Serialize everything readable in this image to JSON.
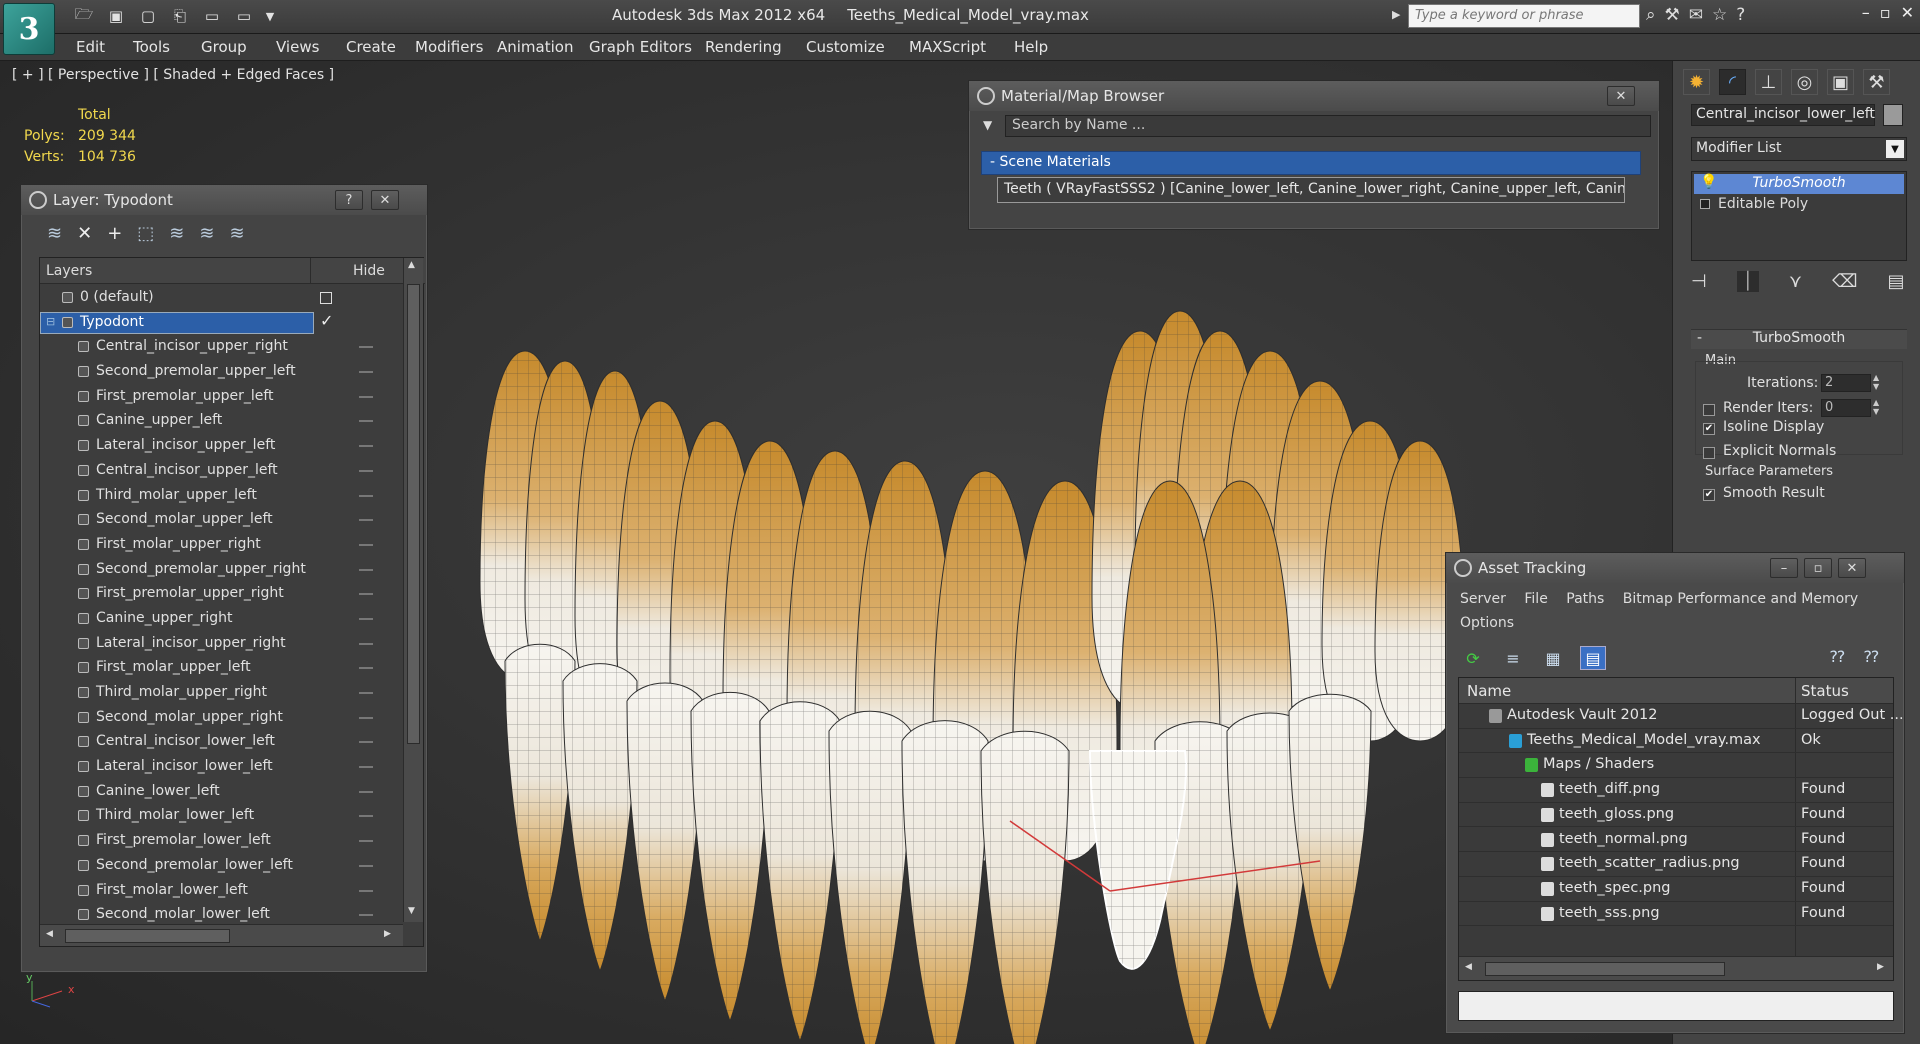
{
  "app": {
    "title": "Autodesk 3ds Max  2012 x64",
    "file": "Teeths_Medical_Model_vray.max",
    "logo": "3",
    "search_placeholder": "Type a keyword or phrase"
  },
  "menu": [
    "Edit",
    "Tools",
    "Group",
    "Views",
    "Create",
    "Modifiers",
    "Animation",
    "Graph Editors",
    "Rendering",
    "Customize",
    "MAXScript",
    "Help"
  ],
  "viewport": {
    "label": "[ + ] [ Perspective ] [ Shaded + Edged Faces ]",
    "stats_total": "Total",
    "polys_label": "Polys:",
    "polys": "209 344",
    "verts_label": "Verts:",
    "verts": "104 736",
    "axis_x": "x",
    "axis_y": "y"
  },
  "layer_window": {
    "title": "Layer: Typodont",
    "help": "?",
    "close": "✕",
    "col_layers": "Layers",
    "col_hide": "Hide",
    "default_layer": "0 (default)",
    "active_layer": "Typodont",
    "check": "✓",
    "objects": [
      "Central_incisor_upper_right",
      "Second_premolar_upper_left",
      "First_premolar_upper_left",
      "Canine_upper_left",
      "Lateral_incisor_upper_left",
      "Central_incisor_upper_left",
      "Third_molar_upper_left",
      "Second_molar_upper_left",
      "First_molar_upper_right",
      "Second_premolar_upper_right",
      "First_premolar_upper_right",
      "Canine_upper_right",
      "Lateral_incisor_upper_right",
      "First_molar_upper_left",
      "Third_molar_upper_right",
      "Second_molar_upper_right",
      "Central_incisor_lower_left",
      "Lateral_incisor_lower_left",
      "Canine_lower_left",
      "Third_molar_lower_left",
      "First_premolar_lower_left",
      "Second_premolar_lower_left",
      "First_molar_lower_left",
      "Second_molar_lower_left"
    ]
  },
  "material_browser": {
    "title": "Material/Map Browser",
    "close": "✕",
    "search_placeholder": "Search by Name ...",
    "section": "- Scene Materials",
    "item": "Teeth  ( VRayFastSSS2 )  [Canine_lower_left, Canine_lower_right, Canine_upper_left, Canine..."
  },
  "command_panel": {
    "object_name": "Central_incisor_lower_left",
    "modifier_list": "Modifier List",
    "stack": [
      "TurboSmooth",
      "Editable Poly"
    ],
    "rollout_title": "TurboSmooth",
    "rollout_collapse": "-",
    "group_main": "Main",
    "iterations_label": "Iterations:",
    "iterations": "2",
    "render_iters_label": "Render Iters:",
    "render_iters": "0",
    "isoline_label": "Isoline Display",
    "isoline_checked": true,
    "explicit_label": "Explicit Normals",
    "explicit_checked": false,
    "group_surface": "Surface Parameters",
    "smooth_label": "Smooth Result",
    "smooth_checked": true
  },
  "asset_tracking": {
    "title": "Asset Tracking",
    "menu": [
      "Server",
      "File",
      "Paths",
      "Bitmap Performance and Memory",
      "Options"
    ],
    "col_name": "Name",
    "col_status": "Status",
    "rows": [
      {
        "name": "Autodesk Vault 2012",
        "status": "Logged Out ..."
      },
      {
        "name": "Teeths_Medical_Model_vray.max",
        "status": "Ok"
      },
      {
        "name": "Maps / Shaders",
        "status": ""
      },
      {
        "name": "teeth_diff.png",
        "status": "Found"
      },
      {
        "name": "teeth_gloss.png",
        "status": "Found"
      },
      {
        "name": "teeth_normal.png",
        "status": "Found"
      },
      {
        "name": "teeth_scatter_radius.png",
        "status": "Found"
      },
      {
        "name": "teeth_spec.png",
        "status": "Found"
      },
      {
        "name": "teeth_sss.png",
        "status": "Found"
      }
    ]
  },
  "colors": {
    "stats": "#f1d84d",
    "selection": "#2c5fa8",
    "tooth_root": "#c68a2c",
    "tooth_crown": "#f2f0ea"
  }
}
